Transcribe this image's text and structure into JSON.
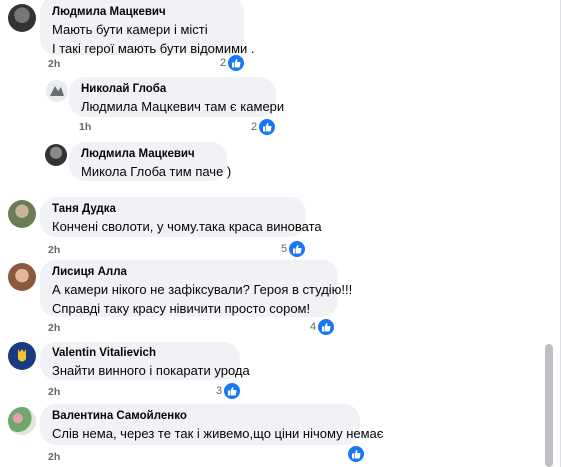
{
  "comments": [
    {
      "author": "Людмила Мацкевич",
      "lines": [
        "Мають бути камери і місті",
        "І такі герої мають бути відомими ."
      ],
      "time": "2h",
      "reactions": "2"
    },
    {
      "author": "Николай Глоба",
      "lines": [
        "Людмила Мацкевич там є камери"
      ],
      "time": "1h",
      "reactions": "2"
    },
    {
      "author": "Людмила Мацкевич",
      "lines": [
        "Микола Глоба тим паче )"
      ],
      "time": "",
      "reactions": ""
    },
    {
      "author": "Таня Дудка",
      "lines": [
        "Кончені сволоти, у чому.така краса виновата"
      ],
      "time": "2h",
      "reactions": "5"
    },
    {
      "author": "Лисиця Алла",
      "lines": [
        "А камери нікого не зафіксували? Героя в студію!!!",
        "Справді таку красу нівичити просто сором!"
      ],
      "time": "2h",
      "reactions": "4"
    },
    {
      "author": "Valentin Vitalievich",
      "lines": [
        "Знайти винного і покарати урода"
      ],
      "time": "2h",
      "reactions": "3"
    },
    {
      "author": "Валентина Самойленко",
      "lines": [
        "Слів нема, через те так і живемо,що ціни нічому немає"
      ],
      "time": "2h",
      "reactions": ""
    }
  ],
  "icons": {
    "like": "thumbs-up-icon"
  },
  "colors": {
    "bubble": "#f0f2f5",
    "like": "#1877f2",
    "meta": "#65676b"
  }
}
